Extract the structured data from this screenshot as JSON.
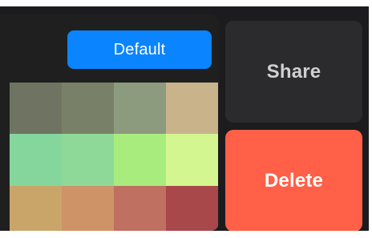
{
  "toolbar": {
    "default_label": "Default"
  },
  "actions": {
    "share_label": "Share",
    "delete_label": "Delete"
  },
  "palette": {
    "rows": [
      [
        "#6f7462",
        "#798068",
        "#8c9a7e",
        "#c8b38b"
      ],
      [
        "#84d69c",
        "#8ed998",
        "#a9ec7e",
        "#d4f690"
      ],
      [
        "#c9a56a",
        "#cf9368",
        "#bf7060",
        "#a8484a"
      ]
    ]
  },
  "colors": {
    "background": "#1c1c1e",
    "panel": "#1f1f1f",
    "accent": "#0a84ff",
    "danger": "#ff6047",
    "secondary_button": "#2b2b2d"
  }
}
